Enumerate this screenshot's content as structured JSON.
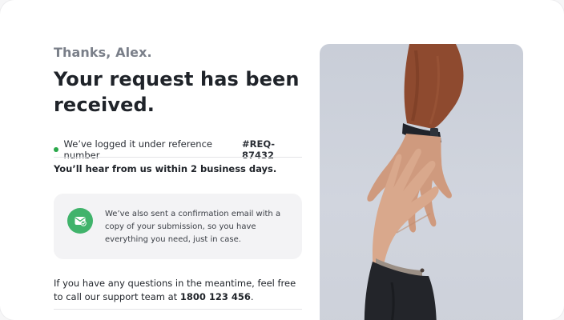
{
  "confirmation": {
    "greeting": "Thanks, Alex.",
    "headline": "Your request has been received.",
    "reference_prefix": "We’ve logged it under reference number",
    "reference_number": "#REQ-87432",
    "timeline": "You’ll hear from us within 2 business days.",
    "email_note": "We’ve also sent a confirmation email with a copy of your submission, so you have everything you need, just in case.",
    "questions_prefix": "If you have any questions in the meantime, feel free to call our support team at",
    "support_phone": "1800 123 456",
    "questions_suffix": "."
  },
  "colors": {
    "status_dot": "#2aa84a",
    "email_icon_bg": "#40b36b",
    "photo_bg": "#cdd2db"
  },
  "icons": {
    "status": "green-dot-icon",
    "email": "mail-check-icon"
  },
  "image": {
    "alt": "Two hands reaching toward each other"
  }
}
